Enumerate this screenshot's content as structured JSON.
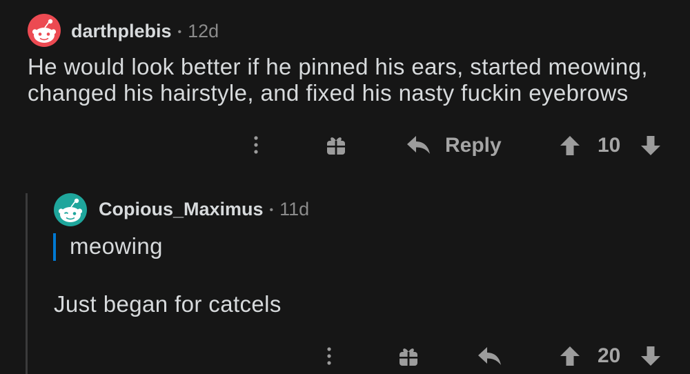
{
  "colors": {
    "background": "#161616",
    "text": "#d7dadc",
    "muted": "#8b8b8b",
    "icon": "#9c9c9c",
    "quote_bar": "#0079d3",
    "thread_line": "#3a3a3b"
  },
  "icons": [
    "more-options-icon",
    "gift-icon",
    "reply-icon",
    "upvote-icon",
    "downvote-icon"
  ],
  "comments": [
    {
      "avatar_color": "#ec4a52",
      "username": "darthplebis",
      "separator": "•",
      "age": "12d",
      "body": "He would look better if he pinned his ears, started meowing, changed his hairstyle, and fixed his nasty fuckin eyebrows",
      "actions": {
        "reply_label": "Reply",
        "score": "10"
      }
    },
    {
      "avatar_color": "#1fa69c",
      "username": "Copious_Maximus",
      "separator": "•",
      "age": "11d",
      "quote": "meowing",
      "body": "Just began for catcels",
      "actions": {
        "score": "20"
      }
    }
  ]
}
